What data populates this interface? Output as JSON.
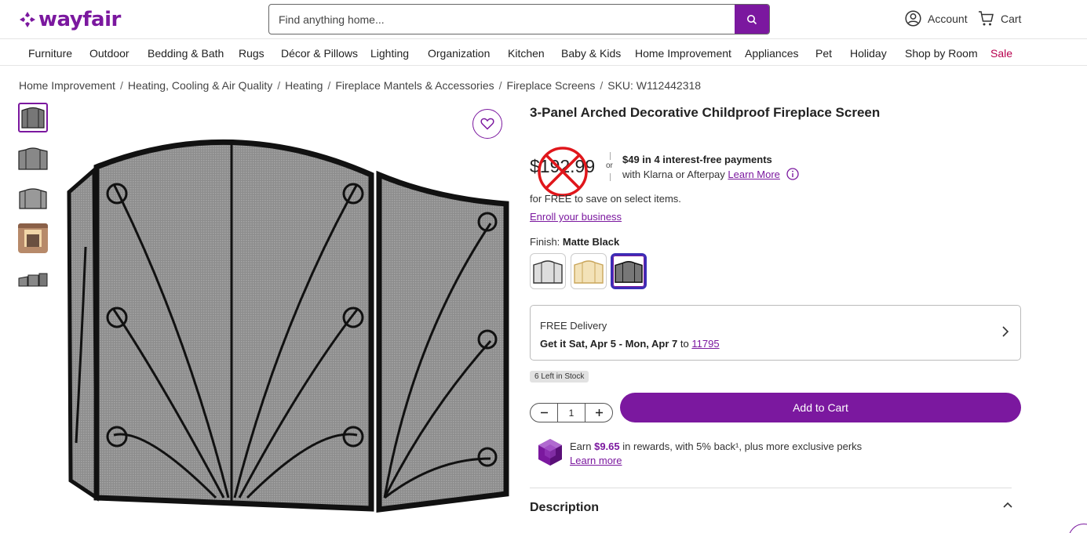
{
  "brand": {
    "name": "wayfair",
    "color": "#7b189f"
  },
  "search": {
    "placeholder": "Find anything home..."
  },
  "header": {
    "account_label": "Account",
    "cart_label": "Cart"
  },
  "nav": {
    "items": [
      "Furniture",
      "Outdoor",
      "Bedding & Bath",
      "Rugs",
      "Décor & Pillows",
      "Lighting",
      "Organization",
      "Kitchen",
      "Baby & Kids",
      "Home Improvement",
      "Appliances",
      "Pet",
      "Holiday",
      "Shop by Room",
      "Sale"
    ]
  },
  "breadcrumb": [
    "Home Improvement",
    "Heating, Cooling & Air Quality",
    "Heating",
    "Fireplace Mantels & Accessories",
    "Fireplace Screens",
    "SKU: W112442318"
  ],
  "product": {
    "title": "3-Panel Arched Decorative Childproof Fireplace Screen",
    "price": "$192.99",
    "or": "or",
    "installments": "$49 in 4 interest-free payments",
    "installments_sub": "with Klarna or Afterpay",
    "learn_more": "Learn More",
    "free_save": "for FREE to save on select items.",
    "enroll": "Enroll your business",
    "finish_label": "Finish:",
    "finish_value": "Matte Black",
    "delivery_line1": "FREE Delivery",
    "delivery_line2": "Get it Sat, Apr 5 - Mon, Apr 7",
    "delivery_to": "to",
    "zip": "11795",
    "stock": "6 Left in Stock",
    "quantity": "1",
    "add_to_cart": "Add to Cart",
    "rewards_pre": "Earn",
    "rewards_amount": "$9.65",
    "rewards_post": "in rewards, with 5% back¹, plus more exclusive perks",
    "rewards_link": "Learn more",
    "description_heading": "Description"
  },
  "icons": [
    "search-icon",
    "account-icon",
    "cart-icon",
    "heart-icon",
    "info-icon",
    "chevron-right-icon",
    "chevron-up-icon",
    "minus-icon",
    "plus-icon",
    "rewards-gem-icon",
    "no-entry-overlay-icon"
  ]
}
